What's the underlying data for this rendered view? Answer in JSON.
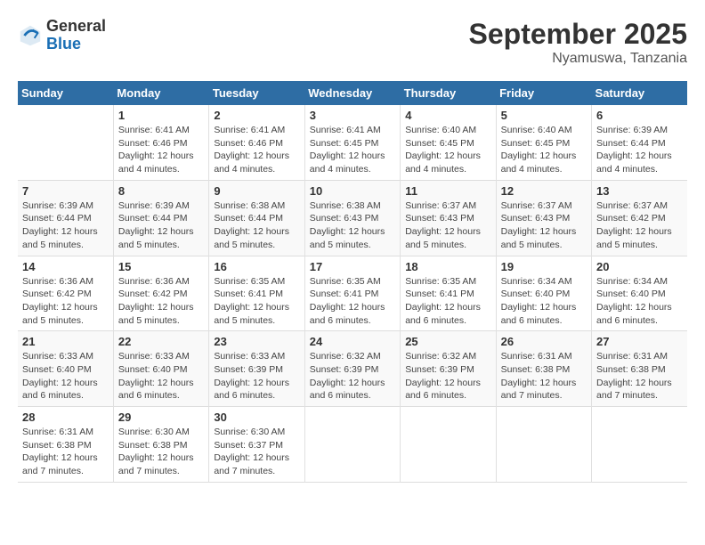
{
  "logo": {
    "general": "General",
    "blue": "Blue"
  },
  "title": "September 2025",
  "location": "Nyamuswa, Tanzania",
  "days_header": [
    "Sunday",
    "Monday",
    "Tuesday",
    "Wednesday",
    "Thursday",
    "Friday",
    "Saturday"
  ],
  "weeks": [
    [
      {
        "day": "",
        "info": ""
      },
      {
        "day": "1",
        "info": "Sunrise: 6:41 AM\nSunset: 6:46 PM\nDaylight: 12 hours\nand 4 minutes."
      },
      {
        "day": "2",
        "info": "Sunrise: 6:41 AM\nSunset: 6:46 PM\nDaylight: 12 hours\nand 4 minutes."
      },
      {
        "day": "3",
        "info": "Sunrise: 6:41 AM\nSunset: 6:45 PM\nDaylight: 12 hours\nand 4 minutes."
      },
      {
        "day": "4",
        "info": "Sunrise: 6:40 AM\nSunset: 6:45 PM\nDaylight: 12 hours\nand 4 minutes."
      },
      {
        "day": "5",
        "info": "Sunrise: 6:40 AM\nSunset: 6:45 PM\nDaylight: 12 hours\nand 4 minutes."
      },
      {
        "day": "6",
        "info": "Sunrise: 6:39 AM\nSunset: 6:44 PM\nDaylight: 12 hours\nand 4 minutes."
      }
    ],
    [
      {
        "day": "7",
        "info": "Sunrise: 6:39 AM\nSunset: 6:44 PM\nDaylight: 12 hours\nand 5 minutes."
      },
      {
        "day": "8",
        "info": "Sunrise: 6:39 AM\nSunset: 6:44 PM\nDaylight: 12 hours\nand 5 minutes."
      },
      {
        "day": "9",
        "info": "Sunrise: 6:38 AM\nSunset: 6:44 PM\nDaylight: 12 hours\nand 5 minutes."
      },
      {
        "day": "10",
        "info": "Sunrise: 6:38 AM\nSunset: 6:43 PM\nDaylight: 12 hours\nand 5 minutes."
      },
      {
        "day": "11",
        "info": "Sunrise: 6:37 AM\nSunset: 6:43 PM\nDaylight: 12 hours\nand 5 minutes."
      },
      {
        "day": "12",
        "info": "Sunrise: 6:37 AM\nSunset: 6:43 PM\nDaylight: 12 hours\nand 5 minutes."
      },
      {
        "day": "13",
        "info": "Sunrise: 6:37 AM\nSunset: 6:42 PM\nDaylight: 12 hours\nand 5 minutes."
      }
    ],
    [
      {
        "day": "14",
        "info": "Sunrise: 6:36 AM\nSunset: 6:42 PM\nDaylight: 12 hours\nand 5 minutes."
      },
      {
        "day": "15",
        "info": "Sunrise: 6:36 AM\nSunset: 6:42 PM\nDaylight: 12 hours\nand 5 minutes."
      },
      {
        "day": "16",
        "info": "Sunrise: 6:35 AM\nSunset: 6:41 PM\nDaylight: 12 hours\nand 5 minutes."
      },
      {
        "day": "17",
        "info": "Sunrise: 6:35 AM\nSunset: 6:41 PM\nDaylight: 12 hours\nand 6 minutes."
      },
      {
        "day": "18",
        "info": "Sunrise: 6:35 AM\nSunset: 6:41 PM\nDaylight: 12 hours\nand 6 minutes."
      },
      {
        "day": "19",
        "info": "Sunrise: 6:34 AM\nSunset: 6:40 PM\nDaylight: 12 hours\nand 6 minutes."
      },
      {
        "day": "20",
        "info": "Sunrise: 6:34 AM\nSunset: 6:40 PM\nDaylight: 12 hours\nand 6 minutes."
      }
    ],
    [
      {
        "day": "21",
        "info": "Sunrise: 6:33 AM\nSunset: 6:40 PM\nDaylight: 12 hours\nand 6 minutes."
      },
      {
        "day": "22",
        "info": "Sunrise: 6:33 AM\nSunset: 6:40 PM\nDaylight: 12 hours\nand 6 minutes."
      },
      {
        "day": "23",
        "info": "Sunrise: 6:33 AM\nSunset: 6:39 PM\nDaylight: 12 hours\nand 6 minutes."
      },
      {
        "day": "24",
        "info": "Sunrise: 6:32 AM\nSunset: 6:39 PM\nDaylight: 12 hours\nand 6 minutes."
      },
      {
        "day": "25",
        "info": "Sunrise: 6:32 AM\nSunset: 6:39 PM\nDaylight: 12 hours\nand 6 minutes."
      },
      {
        "day": "26",
        "info": "Sunrise: 6:31 AM\nSunset: 6:38 PM\nDaylight: 12 hours\nand 7 minutes."
      },
      {
        "day": "27",
        "info": "Sunrise: 6:31 AM\nSunset: 6:38 PM\nDaylight: 12 hours\nand 7 minutes."
      }
    ],
    [
      {
        "day": "28",
        "info": "Sunrise: 6:31 AM\nSunset: 6:38 PM\nDaylight: 12 hours\nand 7 minutes."
      },
      {
        "day": "29",
        "info": "Sunrise: 6:30 AM\nSunset: 6:38 PM\nDaylight: 12 hours\nand 7 minutes."
      },
      {
        "day": "30",
        "info": "Sunrise: 6:30 AM\nSunset: 6:37 PM\nDaylight: 12 hours\nand 7 minutes."
      },
      {
        "day": "",
        "info": ""
      },
      {
        "day": "",
        "info": ""
      },
      {
        "day": "",
        "info": ""
      },
      {
        "day": "",
        "info": ""
      }
    ]
  ]
}
